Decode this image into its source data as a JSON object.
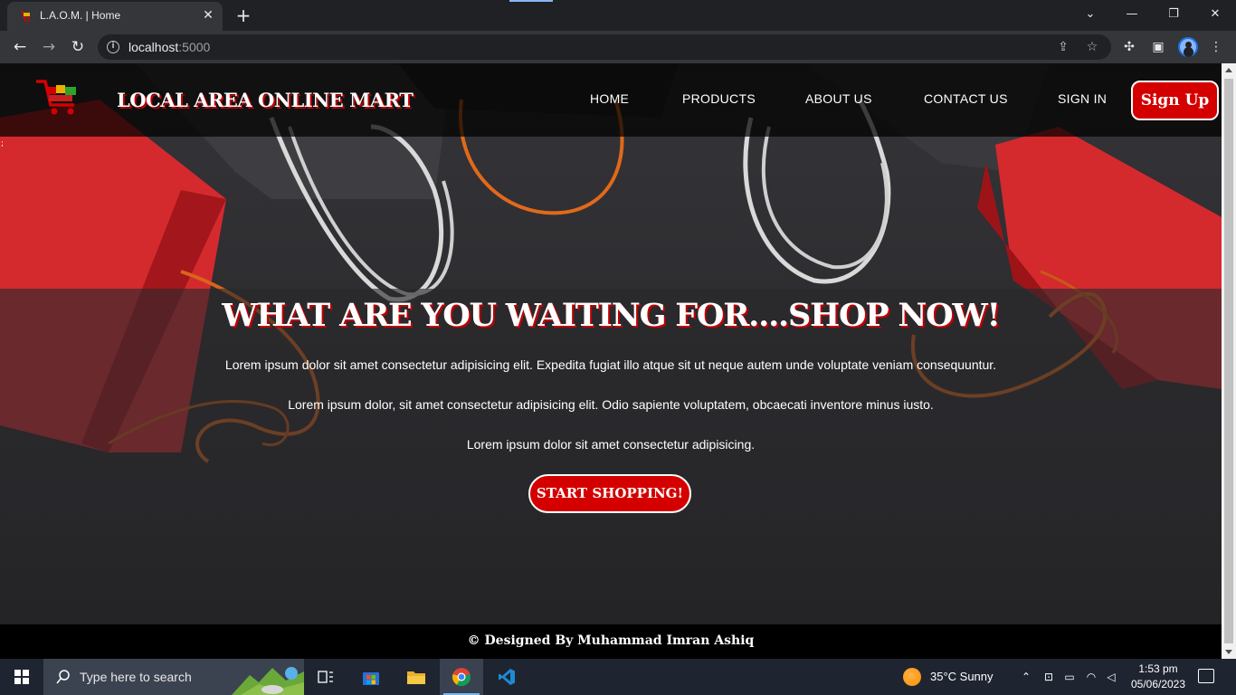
{
  "browser": {
    "tab_title": "L.A.O.M. | Home",
    "url_host": "localhost",
    "url_port": ":5000"
  },
  "site": {
    "brand": "LOCAL AREA ONLINE MART",
    "nav": [
      {
        "label": "HOME"
      },
      {
        "label": "PRODUCTS"
      },
      {
        "label": "ABOUT US"
      },
      {
        "label": "CONTACT US"
      },
      {
        "label": "SIGN IN"
      }
    ],
    "signup_label": "Sign Up",
    "stray_mark": ";",
    "hero": {
      "title": "WHAT ARE YOU WAITING FOR....SHOP NOW!",
      "paragraphs": [
        "Lorem ipsum dolor sit amet consectetur adipisicing elit. Expedita fugiat illo atque sit ut neque autem unde voluptate veniam consequuntur.",
        "Lorem ipsum dolor, sit amet consectetur adipisicing elit. Odio sapiente voluptatem, obcaecati inventore minus iusto.",
        "Lorem ipsum dolor sit amet consectetur adipisicing."
      ],
      "cta_label": "START SHOPPING!"
    },
    "footer": "© Designed By Muhammad Imran Ashiq"
  },
  "taskbar": {
    "search_placeholder": "Type here to search",
    "weather": "35°C  Sunny",
    "time": "1:53 pm",
    "date": "05/06/2023"
  },
  "colors": {
    "accent_red": "#d40000",
    "navbar_bg": "#000000",
    "browser_bg": "#202124",
    "taskbar_bg": "#1e2530"
  }
}
